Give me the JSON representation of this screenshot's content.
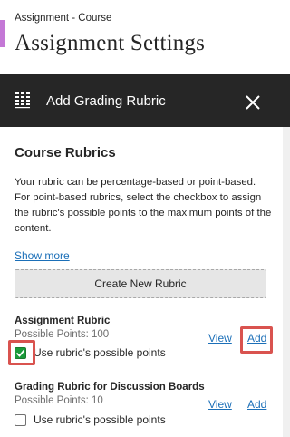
{
  "header": {
    "breadcrumb": "Assignment - Course",
    "title": "Assignment Settings"
  },
  "panel": {
    "title": "Add Grading Rubric",
    "icon": "rubric-grid-icon",
    "close_icon": "close-icon"
  },
  "course_rubrics": {
    "heading": "Course Rubrics",
    "description": "Your rubric can be percentage-based or point-based. For point-based rubrics, select the checkbox to assign the rubric's possible points to the maximum points of the content.",
    "show_more": "Show more",
    "create_button": "Create New Rubric",
    "items": [
      {
        "name": "Assignment Rubric",
        "points": "Possible Points: 100",
        "view": "View",
        "add": "Add",
        "checkbox_label": "Use rubric's possible points",
        "checked": true
      },
      {
        "name": "Grading Rubric for Discussion Boards",
        "points": "Possible Points: 10",
        "view": "View",
        "add": "Add",
        "checkbox_label": "Use rubric's possible points",
        "checked": false
      }
    ]
  },
  "colors": {
    "accent": "#c478d6",
    "panel_header": "#262626",
    "link": "#1b6fb8",
    "highlight": "#d9534f",
    "checkbox_checked": "#1a9a3a"
  }
}
